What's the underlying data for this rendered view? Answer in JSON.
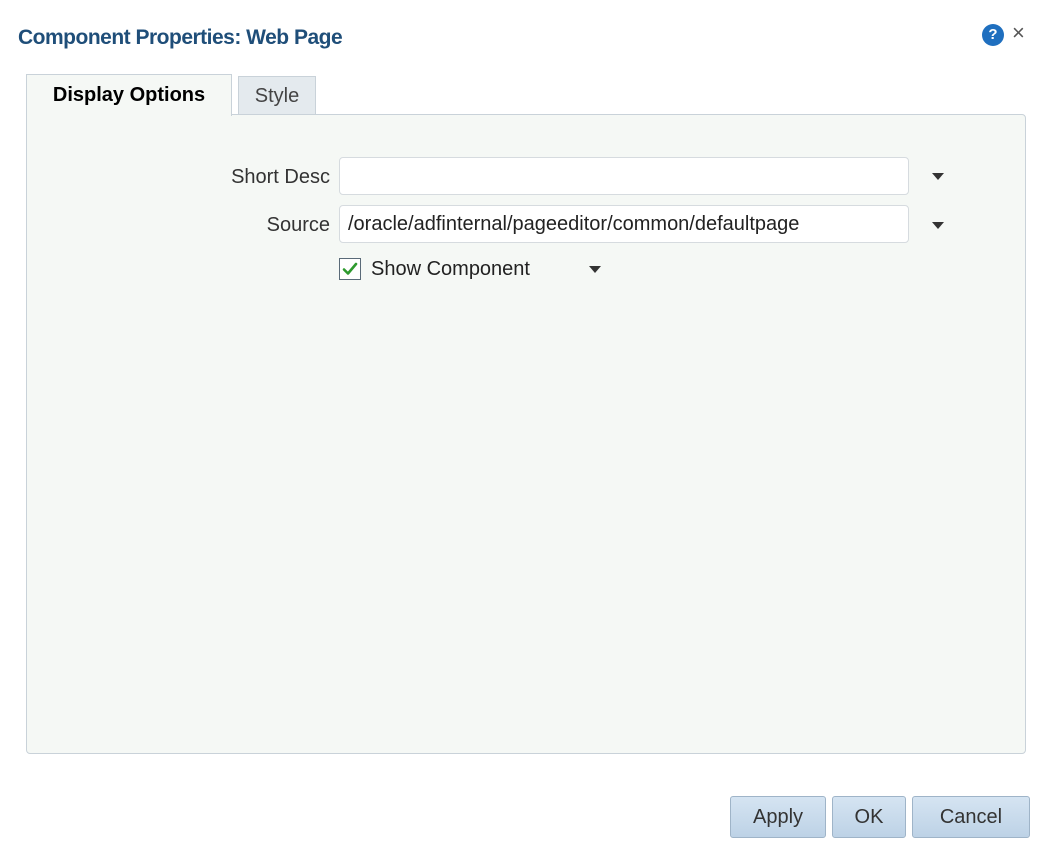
{
  "dialog": {
    "title": "Component Properties: Web Page",
    "help_icon": "help-icon",
    "help_glyph": "?",
    "close_glyph": "×"
  },
  "tabs": [
    {
      "label": "Display Options",
      "selected": true
    },
    {
      "label": "Style",
      "selected": false
    }
  ],
  "form": {
    "short_desc": {
      "label": "Short Desc",
      "value": ""
    },
    "source": {
      "label": "Source",
      "value": "/oracle/adfinternal/pageeditor/common/defaultpage"
    },
    "show_component": {
      "label": "Show Component",
      "checked": true
    }
  },
  "buttons": {
    "apply": "Apply",
    "ok": "OK",
    "cancel": "Cancel"
  },
  "colors": {
    "title": "#1f4e79",
    "help_icon": "#1f6fbf",
    "checkmark": "#2e9a2e",
    "panel_background": "#f5f8f5",
    "button_background": "#c8dbed"
  }
}
